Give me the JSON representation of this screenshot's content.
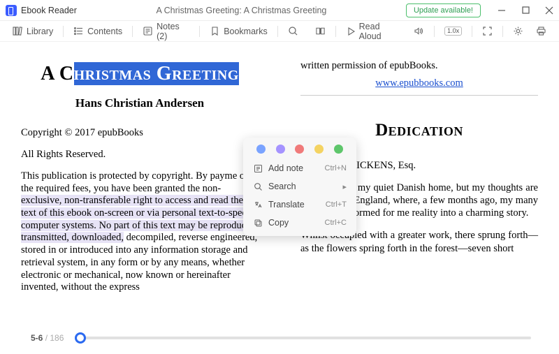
{
  "titlebar": {
    "app_name": "Ebook Reader",
    "document_title": "A Christmas Greeting: A Christmas Greeting",
    "update_label": "Update available!"
  },
  "toolbar": {
    "library": "Library",
    "contents": "Contents",
    "notes": "Notes (2)",
    "bookmarks": "Bookmarks",
    "read_aloud": "Read Aloud",
    "speed": "1.0x"
  },
  "left_page": {
    "title_plain": "A C",
    "title_highlighted": "hristmas Greeting",
    "author": "Hans Christian Andersen",
    "copyright": "Copyright © 2017 epubBooks",
    "rights": "All Rights Reserved.",
    "para_pre": "This publication is protected by copyright. By payme  of the required fees, you have been granted the non-",
    "para_hl": "exclusive, non-transferable right to access and read the text of this ebook on-screen or via personal text-to-speech computer systems. No part of this text may be reproduced, transmitted, downloaded,",
    "para_post": " decompiled, reverse engineered, stored in or introduced into any information storage and retrieval system, in any form or by any means, whether electronic or mechanical, now known or hereinafter invented, without the express"
  },
  "right_page": {
    "perm": "written permission of epubBooks.",
    "link": "www.epubbooks.com",
    "dedication_title": "Dedication",
    "addressee": "CHARLES DICKENS, Esq.",
    "para1": "I am again in my quiet Danish home, but my thoughts are daily in dear England, where, a few months ago, my many friends transformed for me reality into a charming story.",
    "para2": "Whilst occupied with a greater work, there sprung forth—as the flowers spring forth in the forest—seven short"
  },
  "context_menu": {
    "colors": [
      "#7aa3ff",
      "#a593ff",
      "#f07a7a",
      "#f4d362",
      "#5ec66b"
    ],
    "add_note": {
      "label": "Add note",
      "shortcut": "Ctrl+N"
    },
    "search": {
      "label": "Search"
    },
    "translate": {
      "label": "Translate",
      "shortcut": "Ctrl+T"
    },
    "copy": {
      "label": "Copy",
      "shortcut": "Ctrl+C"
    }
  },
  "footer": {
    "current": "5-6",
    "total": "186"
  }
}
